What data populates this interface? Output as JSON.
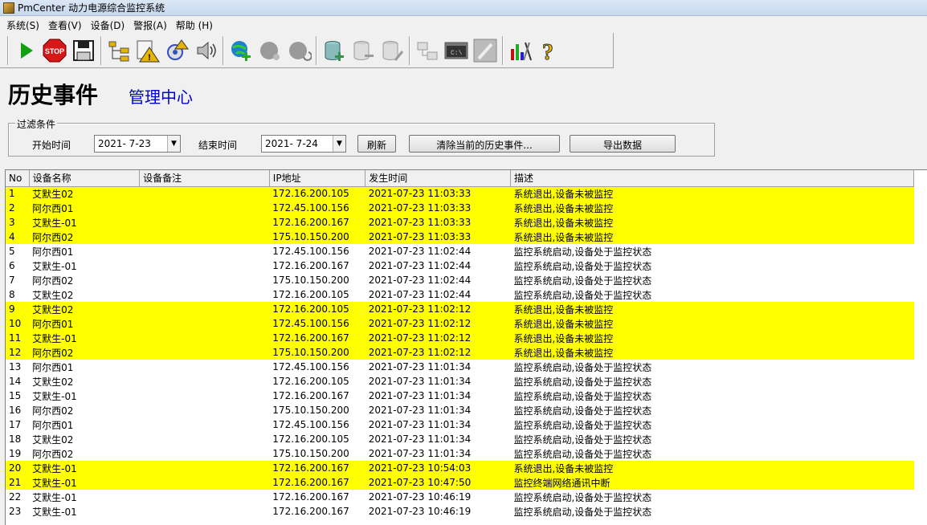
{
  "window": {
    "title": "PmCenter 动力电源综合监控系统"
  },
  "menu": [
    "系统(S)",
    "查看(V)",
    "设备(D)",
    "警报(A)",
    "帮助 (H)"
  ],
  "toolbar": {
    "groups": [
      [
        {
          "name": "play-icon",
          "color": "#12a012"
        },
        {
          "name": "stop-icon",
          "label": "STOP",
          "color": "#d81818"
        },
        {
          "name": "save-icon",
          "color": "#202020"
        }
      ],
      [
        {
          "name": "tree-icon",
          "color": "#e8b400"
        },
        {
          "name": "alarm-warning-icon",
          "color": "#e8b400"
        },
        {
          "name": "alarm-settings-icon",
          "color": "#3050c0"
        },
        {
          "name": "speaker-icon",
          "color": "#404040"
        }
      ],
      [
        {
          "name": "globe-add-icon",
          "color": "#1d7fd0"
        },
        {
          "name": "globe-disabled-icon",
          "color": "#9a9a9a"
        },
        {
          "name": "globe-refresh-disabled-icon",
          "color": "#9a9a9a"
        }
      ],
      [
        {
          "name": "database-add-icon",
          "color": "#3a8f4a"
        },
        {
          "name": "database-remove-disabled-icon",
          "color": "#9a9a9a"
        },
        {
          "name": "database-edit-disabled-icon",
          "color": "#9a9a9a"
        }
      ],
      [
        {
          "name": "network-disabled-icon",
          "color": "#9a9a9a"
        },
        {
          "name": "console-disabled-icon",
          "label": "C:\\",
          "color": "#9a9a9a"
        },
        {
          "name": "pen-disabled-icon",
          "color": "#9a9a9a"
        }
      ],
      [
        {
          "name": "chart-tools-icon",
          "color": "#c01010"
        },
        {
          "name": "help-icon",
          "label": "?",
          "color": "#e8b400"
        }
      ]
    ]
  },
  "page": {
    "title": "历史事件",
    "subtitle": "管理中心"
  },
  "filter": {
    "legend": "过滤条件",
    "start_label": "开始时间",
    "start_value": "2021- 7-23",
    "end_label": "结束时间",
    "end_value": "2021- 7-24",
    "refresh_label": "刷新",
    "clear_label": "清除当前的历史事件...",
    "export_label": "导出数据"
  },
  "table": {
    "columns": [
      "No",
      "设备名称",
      "设备备注",
      "IP地址",
      "发生时间",
      "描述"
    ],
    "highlight_color": "#ffff00",
    "rows": [
      {
        "no": "1",
        "name": "艾默生02",
        "note": "",
        "ip": "172.16.200.105",
        "time": "2021-07-23 11:03:33",
        "desc": "系统退出,设备未被监控",
        "hl": true
      },
      {
        "no": "2",
        "name": "阿尔西01",
        "note": "",
        "ip": "172.45.100.156",
        "time": "2021-07-23 11:03:33",
        "desc": "系统退出,设备未被监控",
        "hl": true
      },
      {
        "no": "3",
        "name": "艾默生-01",
        "note": "",
        "ip": "172.16.200.167",
        "time": "2021-07-23 11:03:33",
        "desc": "系统退出,设备未被监控",
        "hl": true
      },
      {
        "no": "4",
        "name": "阿尔西02",
        "note": "",
        "ip": "175.10.150.200",
        "time": "2021-07-23 11:03:33",
        "desc": "系统退出,设备未被监控",
        "hl": true
      },
      {
        "no": "5",
        "name": "阿尔西01",
        "note": "",
        "ip": "172.45.100.156",
        "time": "2021-07-23 11:02:44",
        "desc": "监控系统启动,设备处于监控状态",
        "hl": false
      },
      {
        "no": "6",
        "name": "艾默生-01",
        "note": "",
        "ip": "172.16.200.167",
        "time": "2021-07-23 11:02:44",
        "desc": "监控系统启动,设备处于监控状态",
        "hl": false
      },
      {
        "no": "7",
        "name": "阿尔西02",
        "note": "",
        "ip": "175.10.150.200",
        "time": "2021-07-23 11:02:44",
        "desc": "监控系统启动,设备处于监控状态",
        "hl": false
      },
      {
        "no": "8",
        "name": "艾默生02",
        "note": "",
        "ip": "172.16.200.105",
        "time": "2021-07-23 11:02:44",
        "desc": "监控系统启动,设备处于监控状态",
        "hl": false
      },
      {
        "no": "9",
        "name": "艾默生02",
        "note": "",
        "ip": "172.16.200.105",
        "time": "2021-07-23 11:02:12",
        "desc": "系统退出,设备未被监控",
        "hl": true
      },
      {
        "no": "10",
        "name": "阿尔西01",
        "note": "",
        "ip": "172.45.100.156",
        "time": "2021-07-23 11:02:12",
        "desc": "系统退出,设备未被监控",
        "hl": true
      },
      {
        "no": "11",
        "name": "艾默生-01",
        "note": "",
        "ip": "172.16.200.167",
        "time": "2021-07-23 11:02:12",
        "desc": "系统退出,设备未被监控",
        "hl": true
      },
      {
        "no": "12",
        "name": "阿尔西02",
        "note": "",
        "ip": "175.10.150.200",
        "time": "2021-07-23 11:02:12",
        "desc": "系统退出,设备未被监控",
        "hl": true
      },
      {
        "no": "13",
        "name": "阿尔西01",
        "note": "",
        "ip": "172.45.100.156",
        "time": "2021-07-23 11:01:34",
        "desc": "监控系统启动,设备处于监控状态",
        "hl": false
      },
      {
        "no": "14",
        "name": "艾默生02",
        "note": "",
        "ip": "172.16.200.105",
        "time": "2021-07-23 11:01:34",
        "desc": "监控系统启动,设备处于监控状态",
        "hl": false
      },
      {
        "no": "15",
        "name": "艾默生-01",
        "note": "",
        "ip": "172.16.200.167",
        "time": "2021-07-23 11:01:34",
        "desc": "监控系统启动,设备处于监控状态",
        "hl": false
      },
      {
        "no": "16",
        "name": "阿尔西02",
        "note": "",
        "ip": "175.10.150.200",
        "time": "2021-07-23 11:01:34",
        "desc": "监控系统启动,设备处于监控状态",
        "hl": false
      },
      {
        "no": "17",
        "name": "阿尔西01",
        "note": "",
        "ip": "172.45.100.156",
        "time": "2021-07-23 11:01:34",
        "desc": "监控系统启动,设备处于监控状态",
        "hl": false
      },
      {
        "no": "18",
        "name": "艾默生02",
        "note": "",
        "ip": "172.16.200.105",
        "time": "2021-07-23 11:01:34",
        "desc": "监控系统启动,设备处于监控状态",
        "hl": false
      },
      {
        "no": "19",
        "name": "阿尔西02",
        "note": "",
        "ip": "175.10.150.200",
        "time": "2021-07-23 11:01:34",
        "desc": "监控系统启动,设备处于监控状态",
        "hl": false
      },
      {
        "no": "20",
        "name": "艾默生-01",
        "note": "",
        "ip": "172.16.200.167",
        "time": "2021-07-23 10:54:03",
        "desc": "系统退出,设备未被监控",
        "hl": true
      },
      {
        "no": "21",
        "name": "艾默生-01",
        "note": "",
        "ip": "172.16.200.167",
        "time": "2021-07-23 10:47:50",
        "desc": "监控终端网络通讯中断",
        "hl": true
      },
      {
        "no": "22",
        "name": "艾默生-01",
        "note": "",
        "ip": "172.16.200.167",
        "time": "2021-07-23 10:46:19",
        "desc": "监控系统启动,设备处于监控状态",
        "hl": false
      },
      {
        "no": "23",
        "name": "艾默生-01",
        "note": "",
        "ip": "172.16.200.167",
        "time": "2021-07-23 10:46:19",
        "desc": "监控系统启动,设备处于监控状态",
        "hl": false
      }
    ]
  }
}
